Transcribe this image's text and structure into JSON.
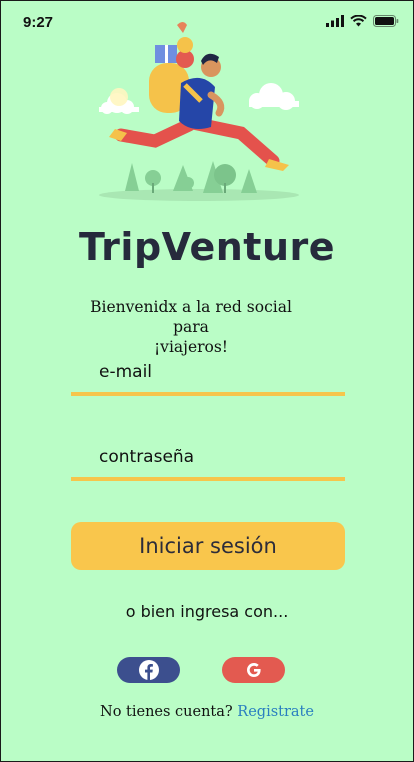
{
  "status_bar": {
    "time": "9:27"
  },
  "brand": {
    "title": "TripVenture"
  },
  "welcome": {
    "line1": "Bienvenidx a la red social para",
    "line2": "¡viajeros!"
  },
  "form": {
    "email_label": "e-mail",
    "password_label": "contraseña",
    "login_label": "Iniciar sesión"
  },
  "alt_login": {
    "text": "o bien ingresa con...",
    "providers": [
      {
        "name": "facebook",
        "icon": "facebook-icon",
        "color": "#3c4f8e"
      },
      {
        "name": "google",
        "icon": "google-icon",
        "color": "#e35a50"
      }
    ]
  },
  "signup": {
    "prompt": "No tienes cuenta?",
    "link": "Registrate"
  },
  "colors": {
    "background": "#bafdc6",
    "accent": "#f9c64c",
    "brand_text": "#262a3c",
    "link": "#2a7fc0"
  }
}
